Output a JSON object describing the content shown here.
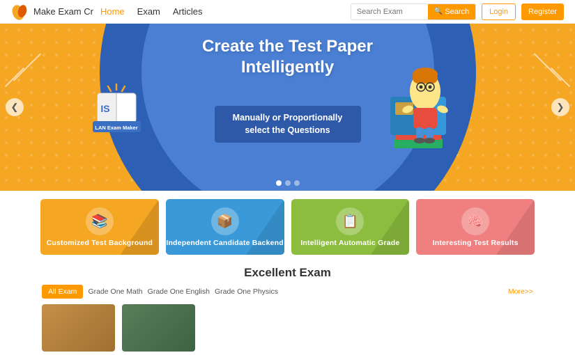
{
  "header": {
    "logo_text": "Make Exam Cr",
    "nav": [
      {
        "label": "Home",
        "active": true
      },
      {
        "label": "Exam",
        "active": false
      },
      {
        "label": "Articles",
        "active": false
      }
    ],
    "search_placeholder": "Search Exam",
    "search_button": "Search",
    "login_button": "Login",
    "register_button": "Register"
  },
  "hero": {
    "title": "Create the Test Paper Intelligently",
    "subtitle": "Manually or Proportionally select the Questions",
    "arrow_left": "❮",
    "arrow_right": "❯"
  },
  "features": [
    {
      "label": "Customized Test Background",
      "color": "yellow",
      "icon": "📚"
    },
    {
      "label": "Independent Candidate Backend",
      "color": "blue",
      "icon": "📦"
    },
    {
      "label": "Intelligent Automatic Grade",
      "color": "green",
      "icon": "📋"
    },
    {
      "label": "Interesting Test Results",
      "color": "pink",
      "icon": "🧠"
    }
  ],
  "excellent": {
    "title": "Excellent Exam",
    "tabs": [
      {
        "label": "All Exam",
        "active": true
      },
      {
        "label": "Grade One Math",
        "active": false
      },
      {
        "label": "Grade One English",
        "active": false
      },
      {
        "label": "Grade One Physics",
        "active": false
      }
    ],
    "more_label": "More>>"
  }
}
